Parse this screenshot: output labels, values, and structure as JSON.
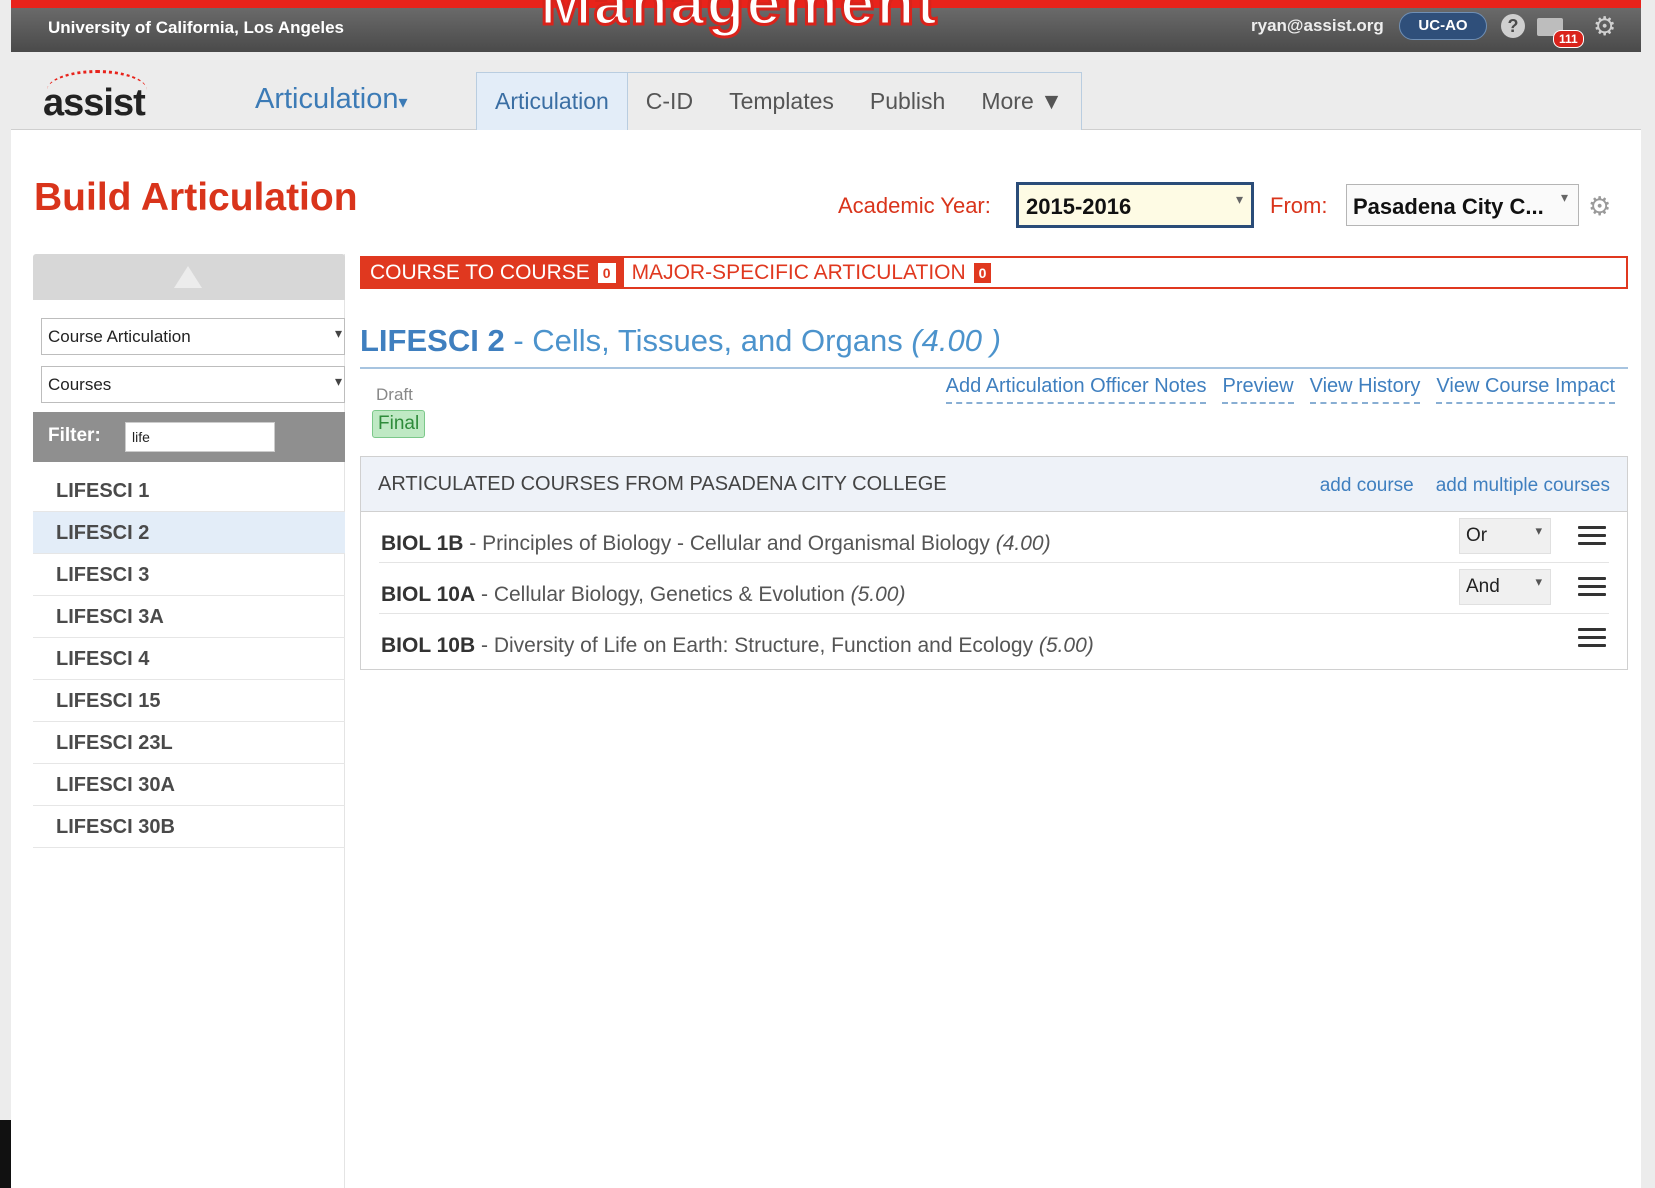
{
  "header": {
    "overlay_title": "Management",
    "org": "University of California, Los Angeles",
    "user_email": "ryan@assist.org",
    "role": "UC-AO",
    "help_icon": "?",
    "mail_count": "111",
    "gear_glyph": "⚙"
  },
  "nav": {
    "logo_text": "assist",
    "app_menu": "Articulation",
    "app_menu_caret": "▾",
    "tabs": [
      "Articulation",
      "C-ID",
      "Templates",
      "Publish",
      "More ▼"
    ]
  },
  "page": {
    "title": "Build Articulation",
    "academic_year_label": "Academic Year:",
    "academic_year_value": "2015-2016",
    "from_label": "From:",
    "from_value": "Pasadena City C...",
    "select_arrow": "▾"
  },
  "sidebar": {
    "type_select": "Course Articulation",
    "view_select": "Courses",
    "filter_label": "Filter:",
    "filter_value": "life",
    "items": [
      "LIFESCI 1",
      "LIFESCI 2",
      "LIFESCI 3",
      "LIFESCI 3A",
      "LIFESCI 4",
      "LIFESCI 15",
      "LIFESCI 23L",
      "LIFESCI 30A",
      "LIFESCI 30B"
    ],
    "selected_index": 1
  },
  "view_tabs": [
    {
      "label": "COURSE TO COURSE",
      "count": "0"
    },
    {
      "label": "MAJOR-SPECIFIC ARTICULATION",
      "count": "0"
    }
  ],
  "course": {
    "code": "LIFESCI 2",
    "title": " - Cells, Tissues, and Organs",
    "units": " (4.00 )"
  },
  "status": {
    "draft": "Draft",
    "final": "Final"
  },
  "actions": [
    "Add Articulation Officer Notes",
    "Preview",
    "View History",
    "View Course Impact"
  ],
  "panel": {
    "title": "ARTICULATED COURSES FROM PASADENA CITY COLLEGE",
    "add_course": "add course",
    "add_multiple": "add multiple courses",
    "rows": [
      {
        "code": "BIOL 1B",
        "title": " - Principles of Biology - Cellular and Organismal Biology ",
        "units": "(4.00)",
        "conjunction": "Or"
      },
      {
        "code": "BIOL 10A",
        "title": " - Cellular Biology, Genetics & Evolution ",
        "units": "(5.00)",
        "conjunction": "And"
      },
      {
        "code": "BIOL 10B",
        "title": " - Diversity of Life on Earth: Structure, Function and Ecology ",
        "units": "(5.00)",
        "conjunction": ""
      }
    ]
  },
  "colors": {
    "brand_red": "#d9341b",
    "link_blue": "#3f7fbf",
    "selected_bg": "#e3edf8",
    "final_green": "#2e8b3a"
  }
}
